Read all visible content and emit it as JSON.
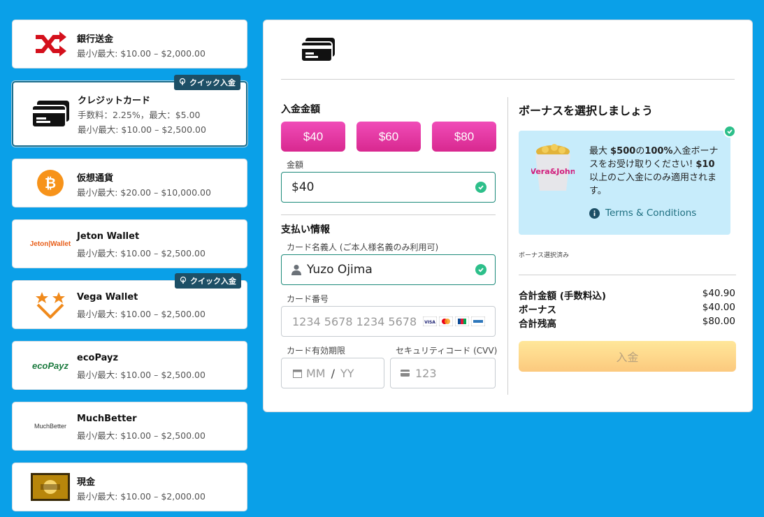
{
  "methods": [
    {
      "name": "銀行送金",
      "line1": "最小/最大: $10.00 – $2,000.00",
      "line2": "",
      "badge": ""
    },
    {
      "name": "クレジットカード",
      "line1": "手数料：2.25%，最大：$5.00",
      "line2": "最小/最大: $10.00 – $2,500.00",
      "badge": "クイック入金"
    },
    {
      "name": "仮想通貨",
      "line1": "最小/最大: $20.00 – $10,000.00",
      "line2": "",
      "badge": ""
    },
    {
      "name": "Jeton Wallet",
      "line1": "最小/最大: $10.00 – $2,500.00",
      "line2": "",
      "badge": "",
      "logo_text": "Jeton|Wallet"
    },
    {
      "name": "Vega Wallet",
      "line1": "最小/最大: $10.00 – $2,500.00",
      "line2": "",
      "badge": "クイック入金"
    },
    {
      "name": "ecoPayz",
      "line1": "最小/最大: $10.00 – $2,500.00",
      "line2": "",
      "badge": "",
      "logo_text": "ecoPayz"
    },
    {
      "name": "MuchBetter",
      "line1": "最小/最大: $10.00 – $2,500.00",
      "line2": "",
      "badge": "",
      "logo_text": "MuchBetter"
    },
    {
      "name": "現金",
      "line1": "最小/最大: $10.00 – $2,000.00",
      "line2": "",
      "badge": ""
    }
  ],
  "deposit": {
    "amount_heading": "入金金額",
    "quick_amounts": [
      "$40",
      "$60",
      "$80"
    ],
    "amount_label": "金額",
    "amount_value": "$40",
    "payment_heading": "支払い情報",
    "holder_label": "カード名義人 (ご本人様名義のみ利用可)",
    "holder_value": "Yuzo Ojima",
    "card_label": "カード番号",
    "card_placeholder": "1234 5678 1234 5678",
    "expiry_label": "カード有効期限",
    "expiry_mm": "MM",
    "expiry_sep": "/",
    "expiry_yy": "YY",
    "cvv_label": "セキュリティコード (CVV)",
    "cvv_placeholder": "123"
  },
  "bonus": {
    "heading": "ボーナスを選択しましょう",
    "text_pre": "最大 ",
    "text_amount": "$500",
    "text_of": "の",
    "text_pct": "100%",
    "text_mid": "入金ボーナスをお受け取りください! ",
    "text_min": "$10",
    "text_post": "以上のご入金にのみ適用されます。",
    "terms": "Terms & Conditions",
    "selected_note": "ボーナス選択済み",
    "logo_text": "Vera&John"
  },
  "summary": {
    "rows": [
      {
        "label": "合計金額 (手数料込)",
        "value": "$40.90"
      },
      {
        "label": "ボーナス",
        "value": "$40.00"
      },
      {
        "label": "合計残高",
        "value": "$80.00"
      }
    ],
    "deposit_button": "入金"
  },
  "colors": {
    "background": "#0aa0e8",
    "accent_pink": "#e3339f",
    "valid_green": "#2dbf8a",
    "badge": "#1d4f66"
  }
}
